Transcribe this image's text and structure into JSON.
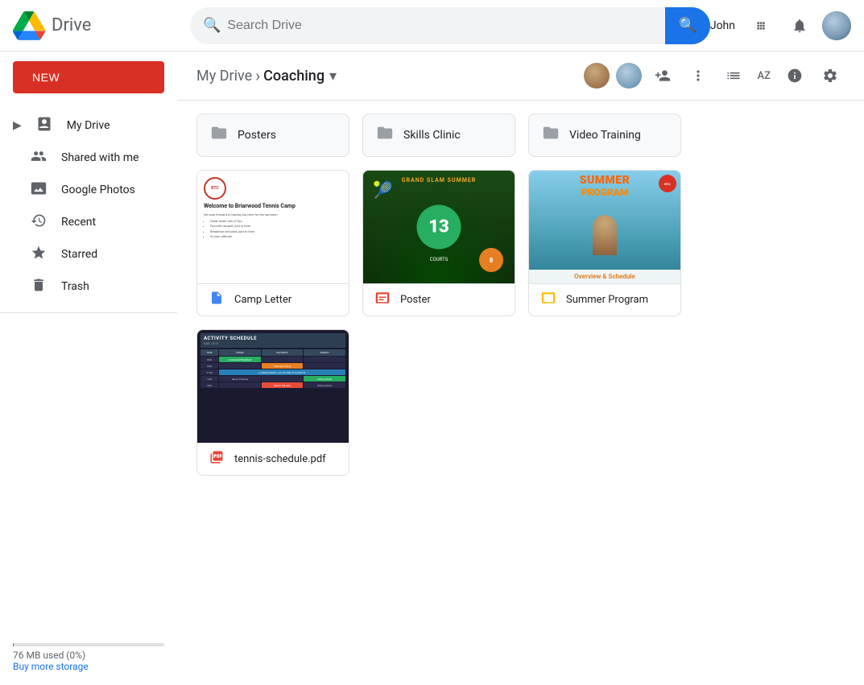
{
  "app": {
    "name": "Drive",
    "logo_alt": "Google Drive"
  },
  "topbar": {
    "search_placeholder": "Search Drive",
    "user_name": "John"
  },
  "sidebar": {
    "new_button": "NEW",
    "nav_items": [
      {
        "id": "my-drive",
        "label": "My Drive",
        "icon": "▶ 🗂"
      },
      {
        "id": "shared-with-me",
        "label": "Shared with me",
        "icon": "👥"
      },
      {
        "id": "google-photos",
        "label": "Google Photos",
        "icon": "✦"
      },
      {
        "id": "recent",
        "label": "Recent",
        "icon": "🕐"
      },
      {
        "id": "starred",
        "label": "Starred",
        "icon": "★"
      },
      {
        "id": "trash",
        "label": "Trash",
        "icon": "🗑"
      }
    ],
    "storage_used": "76 MB used (0%)",
    "buy_storage": "Buy more storage"
  },
  "breadcrumb": {
    "parent": "My Drive",
    "current": "Coaching",
    "arrow": "›"
  },
  "folders": [
    {
      "id": "posters",
      "name": "Posters"
    },
    {
      "id": "skills-clinic",
      "name": "Skills Clinic"
    },
    {
      "id": "video-training",
      "name": "Video Training"
    }
  ],
  "files": [
    {
      "id": "camp-letter",
      "name": "Camp Letter",
      "type": "doc",
      "type_icon": "📄",
      "type_color": "#4285f4"
    },
    {
      "id": "poster",
      "name": "Poster",
      "type": "slides",
      "type_icon": "📊",
      "type_color": "#ea4335"
    },
    {
      "id": "summer-program",
      "name": "Summer Program",
      "type": "slides",
      "type_icon": "📊",
      "type_color": "#fbbc04"
    },
    {
      "id": "tennis-schedule",
      "name": "tennis-schedule.pdf",
      "type": "pdf",
      "type_icon": "📕",
      "type_color": "#ea4335"
    }
  ],
  "header_buttons": {
    "add_person": "+👤",
    "more": "⋮",
    "list_view": "☰",
    "sort": "AZ",
    "info": "ℹ",
    "settings": "⚙"
  },
  "colors": {
    "accent": "#1a73e8",
    "new_button_bg": "#d93025",
    "sidebar_active_bg": "#e8f0fe"
  }
}
